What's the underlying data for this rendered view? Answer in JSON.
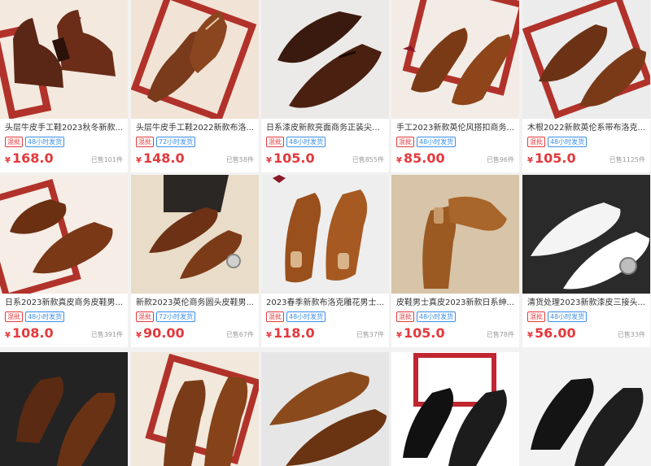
{
  "currency_symbol": "¥",
  "tags": {
    "mix": "混批"
  },
  "products": [
    {
      "title": "头层牛皮手工鞋2023秋冬新款...",
      "ship": "48小时发货",
      "price": "168.0",
      "sold": "已售101件"
    },
    {
      "title": "头层牛皮手工鞋2022新款布洛...",
      "ship": "72小时发货",
      "price": "148.0",
      "sold": "已售58件"
    },
    {
      "title": "日系漆皮新款亮面商务正装尖头...",
      "ship": "48小时发货",
      "price": "105.0",
      "sold": "已售855件"
    },
    {
      "title": "手工2023新款英伦风搭扣商务...",
      "ship": "48小时发货",
      "price": "85.00",
      "sold": "已售96件"
    },
    {
      "title": "木根2022新款英伦系带布洛克...",
      "ship": "48小时发货",
      "price": "105.0",
      "sold": "已售1125件"
    },
    {
      "title": "日系2023新款真皮商务皮鞋男...",
      "ship": "48小时发货",
      "price": "108.0",
      "sold": "已售391件"
    },
    {
      "title": "新款2023英伦商务圆头皮鞋男...",
      "ship": "72小时发货",
      "price": "90.00",
      "sold": "已售67件"
    },
    {
      "title": "2023春季新款布洛克雕花男士...",
      "ship": "48小时发货",
      "price": "118.0",
      "sold": "已售37件"
    },
    {
      "title": "皮鞋男士真皮2023新款日系绅...",
      "ship": "48小时发货",
      "price": "105.0",
      "sold": "已售78件"
    },
    {
      "title": "清货处理2023新款漆皮三接头...",
      "ship": "48小时发货",
      "price": "56.00",
      "sold": "已售33件"
    },
    {
      "title": "",
      "ship": "",
      "price": "",
      "sold": ""
    },
    {
      "title": "",
      "ship": "",
      "price": "",
      "sold": ""
    },
    {
      "title": "",
      "ship": "",
      "price": "",
      "sold": ""
    },
    {
      "title": "",
      "ship": "",
      "price": "",
      "sold": ""
    },
    {
      "title": "",
      "ship": "",
      "price": "",
      "sold": ""
    }
  ]
}
